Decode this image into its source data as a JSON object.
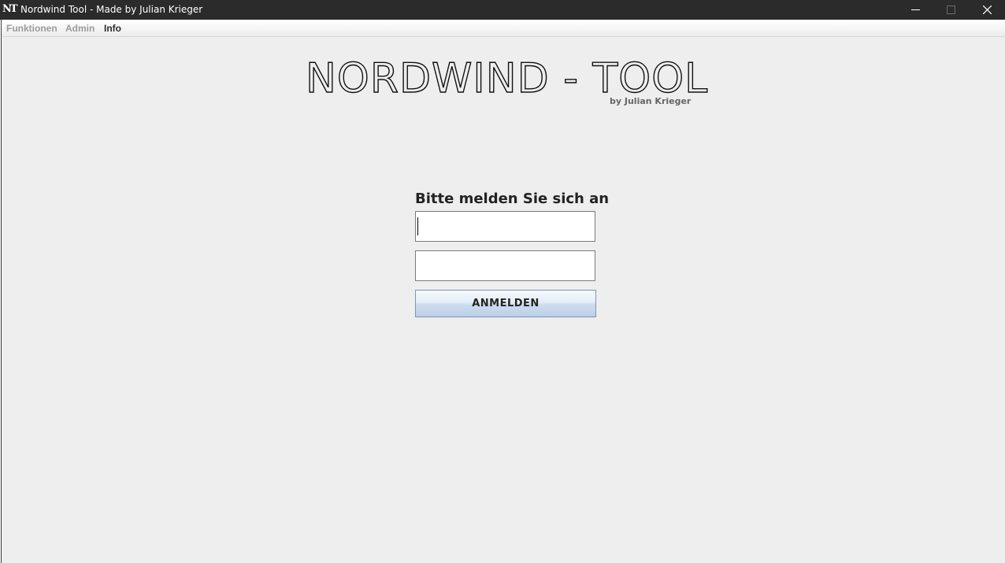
{
  "window": {
    "title": "Nordwind Tool - Made by Julian Krieger",
    "app_icon": "NT",
    "controls": [
      "minimize-icon",
      "maximize-icon",
      "close-icon"
    ]
  },
  "menubar": {
    "items": [
      {
        "label": "Funktionen",
        "enabled": false
      },
      {
        "label": "Admin",
        "enabled": false
      },
      {
        "label": "Info",
        "enabled": true
      }
    ]
  },
  "logo": {
    "title": "NORDWIND - TOOL",
    "subtitle": "by Julian Krieger"
  },
  "login": {
    "heading": "Bitte melden Sie sich an",
    "username_value": "",
    "password_value": "",
    "submit_label": "ANMELDEN"
  },
  "colors": {
    "titlebar": "#2b2b2b",
    "background": "#eeeeee",
    "button_gradient_bottom": "#bcd0e8",
    "disabled_menu": "#9b9b9b"
  }
}
